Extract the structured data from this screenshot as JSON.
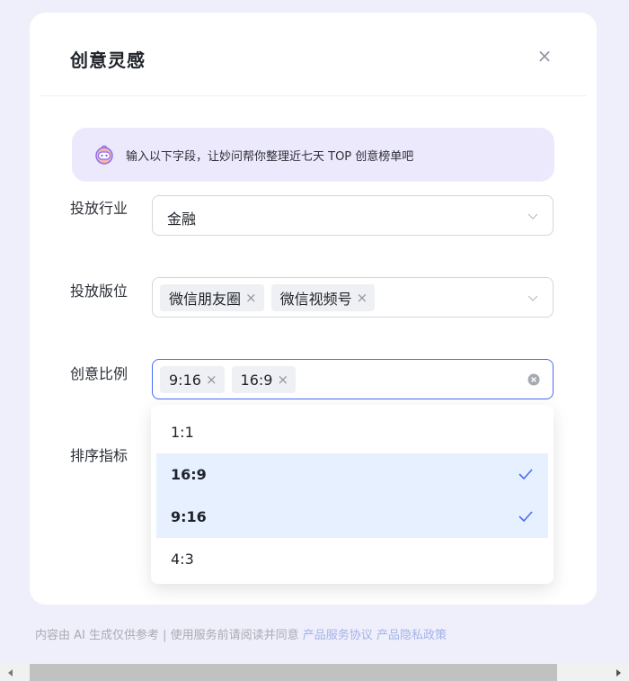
{
  "dialog": {
    "title": "创意灵感",
    "close_label": "×"
  },
  "banner": {
    "icon": "robot-face-icon",
    "text": "输入以下字段，让妙问帮你整理近七天 TOP 创意榜单吧"
  },
  "form": {
    "industry": {
      "label": "投放行业",
      "value": "金融"
    },
    "placement": {
      "label": "投放版位",
      "tags": [
        "微信朋友圈",
        "微信视频号"
      ]
    },
    "ratio": {
      "label": "创意比例",
      "tags": [
        "9:16",
        "16:9"
      ]
    },
    "sort_metric": {
      "label": "排序指标"
    }
  },
  "dropdown": {
    "options": [
      {
        "label": "1:1",
        "selected": false
      },
      {
        "label": "16:9",
        "selected": true
      },
      {
        "label": "9:16",
        "selected": true
      },
      {
        "label": "4:3",
        "selected": false
      }
    ]
  },
  "footer": {
    "disclaimer": "内容由 AI 生成仅供参考 | 使用服务前请阅读并同意",
    "link_service": "产品服务协议",
    "link_privacy": "产品隐私政策"
  },
  "colors": {
    "page_bg": "#efeffb",
    "accent": "#4a6cf7",
    "banner_bg": "#ede9fd",
    "selected_option_bg": "#e6f0ff",
    "link": "#a3b3e8"
  }
}
